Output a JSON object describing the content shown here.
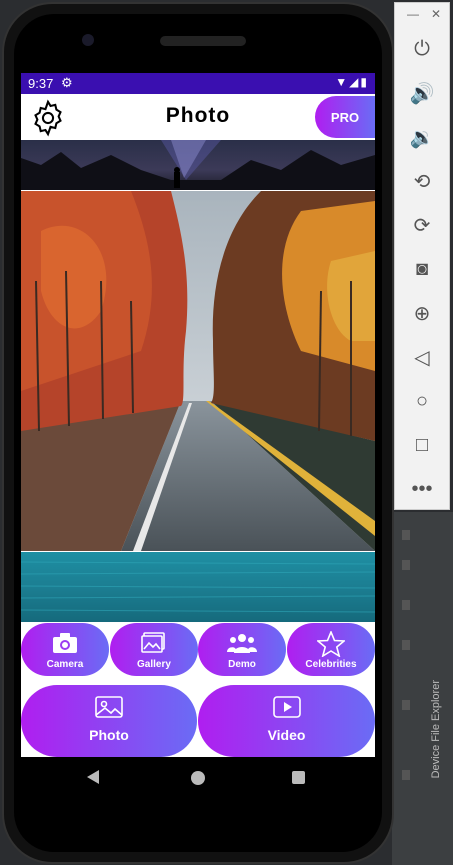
{
  "status_bar": {
    "time": "9:37"
  },
  "app_bar": {
    "title": "Photo",
    "pro_label": "PRO"
  },
  "categories": [
    {
      "label": "Camera",
      "icon": "camera-icon"
    },
    {
      "label": "Gallery",
      "icon": "gallery-icon"
    },
    {
      "label": "Demo",
      "icon": "people-icon"
    },
    {
      "label": "Celebrities",
      "icon": "star-icon"
    }
  ],
  "actions": [
    {
      "label": "Photo",
      "icon": "image-icon"
    },
    {
      "label": "Video",
      "icon": "play-icon"
    }
  ],
  "ide": {
    "side_panel": "Device File Explorer"
  },
  "colors": {
    "status_bar": "#3a0fb0",
    "gradient_start": "#b01ef0",
    "gradient_end": "#6a6cf5"
  }
}
